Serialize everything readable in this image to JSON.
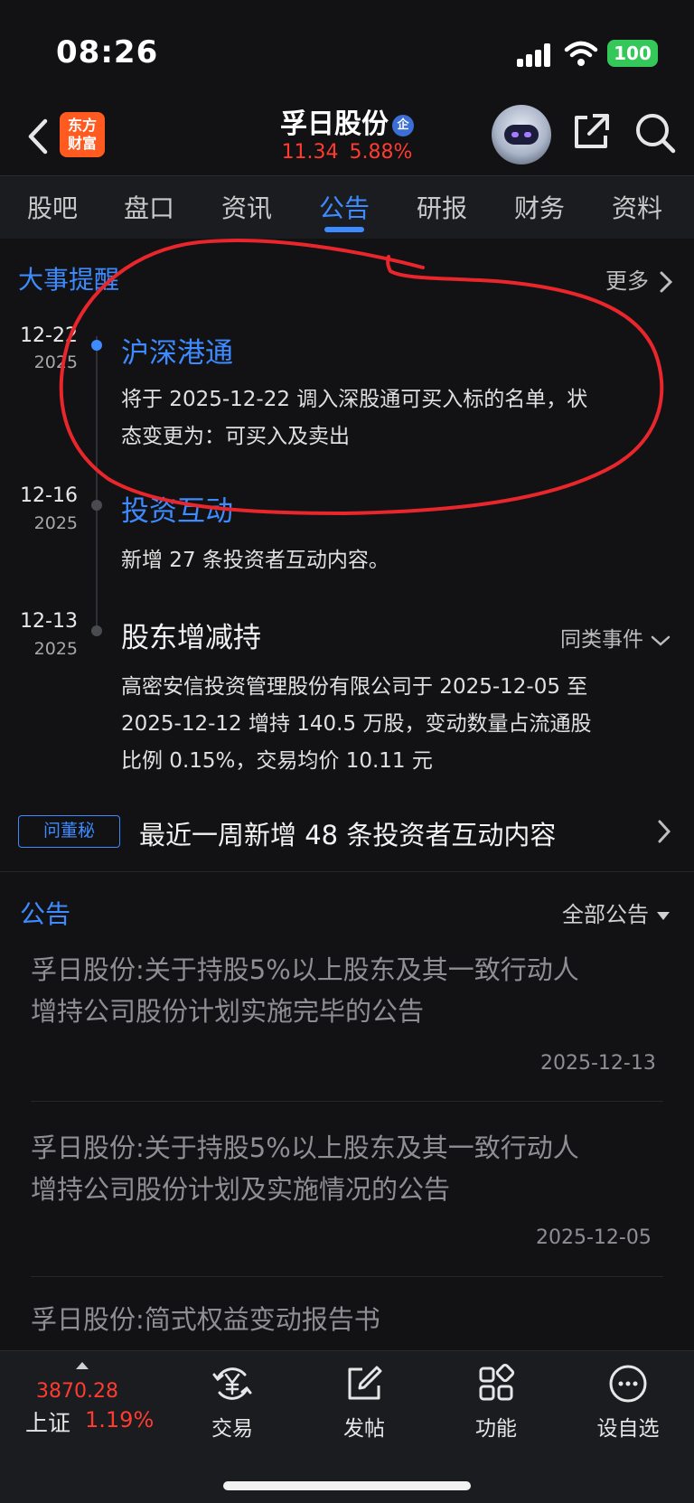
{
  "status_bar": {
    "time": "08:26",
    "battery": "100"
  },
  "header": {
    "logo_line1": "东方",
    "logo_line2": "财富",
    "stock_name": "孚日股份",
    "badge": "企",
    "price": "11.34",
    "change_pct": "5.88%"
  },
  "tabs": [
    {
      "label": "股吧"
    },
    {
      "label": "盘口"
    },
    {
      "label": "资讯"
    },
    {
      "label": "公告"
    },
    {
      "label": "研报"
    },
    {
      "label": "财务"
    },
    {
      "label": "资料"
    }
  ],
  "active_tab": "公告",
  "events": {
    "title": "大事提醒",
    "more_label": "更多",
    "items": [
      {
        "date": "12-22",
        "year": "2025",
        "title": "沪深港通",
        "body_line1": "将于 2025-12-22 调入深股通可买入标的名单，状",
        "body_line2": "态变更为：可买入及卖出"
      },
      {
        "date": "12-16",
        "year": "2025",
        "title": "投资互动",
        "body_line1": "新增 27 条投资者互动内容。"
      },
      {
        "date": "12-13",
        "year": "2025",
        "title": "股东增减持",
        "similar_label": "同类事件",
        "body_line1": "高密安信投资管理股份有限公司于 2025-12-05 至",
        "body_line2": "2025-12-12 增持 140.5 万股，变动数量占流通股",
        "body_line3": "比例 0.15%，交易均价 10.11 元"
      }
    ]
  },
  "dong_mi": {
    "tag": "问董秘",
    "text": "最近一周新增 48 条投资者互动内容"
  },
  "announcements": {
    "title": "公告",
    "filter_label": "全部公告",
    "items": [
      {
        "line1": "孚日股份:关于持股5%以上股东及其一致行动人",
        "line2": "增持公司股份计划实施完毕的公告",
        "date": "2025-12-13"
      },
      {
        "line1": "孚日股份:关于持股5%以上股东及其一致行动人",
        "line2": "增持公司股份计划及实施情况的公告",
        "date": "2025-12-05"
      },
      {
        "line1": "孚日股份:简式权益变动报告书"
      }
    ]
  },
  "bottom_bar": {
    "index_value": "3870.28",
    "index_name": "上证",
    "index_pct": "1.19%",
    "nav": [
      {
        "label": "交易",
        "icon": "yen-exchange-icon"
      },
      {
        "label": "发帖",
        "icon": "edit-post-icon"
      },
      {
        "label": "功能",
        "icon": "grid-apps-icon"
      },
      {
        "label": "设自选",
        "icon": "more-circle-icon"
      }
    ]
  },
  "colors": {
    "accent": "#3d8bff",
    "up_red": "#ff3b30",
    "background": "#121214",
    "annotation": "#e8262b"
  }
}
